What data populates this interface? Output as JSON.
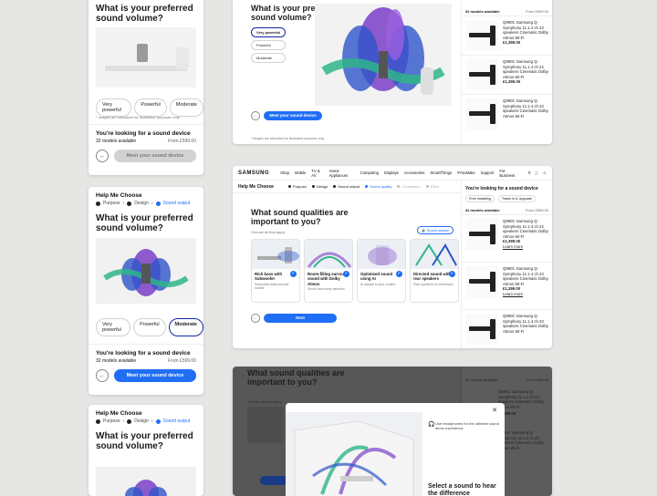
{
  "question_volume": "What is your preferred sound volume?",
  "question_qualities": "What sound qualities are important to you?",
  "options": [
    "Very powerful",
    "Powerful",
    "Moderate"
  ],
  "disclaimer": "* Images are simulated for illustrative purposes only.",
  "looking_title": "You're looking for a sound device",
  "models_count": "32 models available",
  "from_price": "From £599.00",
  "match_button": "Meet your sound device",
  "help_title": "Help Me Choose",
  "steps": [
    "Purpose",
    "Design",
    "Sound output"
  ],
  "brand": "SAMSUNG",
  "nav": [
    "Shop",
    "Mobile",
    "TV & AV",
    "Home Appliances",
    "Computing",
    "Displays",
    "Accessories",
    "SmartThings",
    "#YouMake"
  ],
  "nav_right": [
    "Support",
    "For Business"
  ],
  "step_bar": [
    "Purpose",
    "Design",
    "Sound output",
    "Sound quality",
    "Connection",
    "Extra"
  ],
  "choose_hint": "Choose all that apply",
  "sound_sample": "Sound sample",
  "quality_cards": [
    {
      "label": "Rich bass with Subwoofer",
      "desc": "Subwoofer adds low-end rumble"
    },
    {
      "label": "Room-filling surround sound with Dolby Atmos",
      "desc": "Sound from every direction"
    },
    {
      "label": "Optimised sound using AI",
      "desc": "AI adjusts to your content"
    },
    {
      "label": "Directed sound with rear speakers",
      "desc": "Rear speakers for immersion"
    }
  ],
  "next_button": "Next",
  "sidebar_filters": [
    "Free Installing",
    "Trade-in & Upgrade"
  ],
  "product": {
    "name": "Q990C Samsung Q-Symphony 11.1.4 ch 22 speakers Cinematic Dolby Atmos Wi-Fi",
    "price": "£1,399.00",
    "old_price": "£1,599.00",
    "link": "Learn more"
  },
  "modal": {
    "headphones_note": "Use headphones for the ultimate sound demo experience",
    "select_title": "Select a sound to hear the difference"
  },
  "colors": {
    "accent": "#1f6ef5",
    "brand": "#1428a0",
    "wave_purple": "#7a3fc7",
    "wave_blue": "#2e55c9",
    "wave_green": "#2fb58a"
  }
}
